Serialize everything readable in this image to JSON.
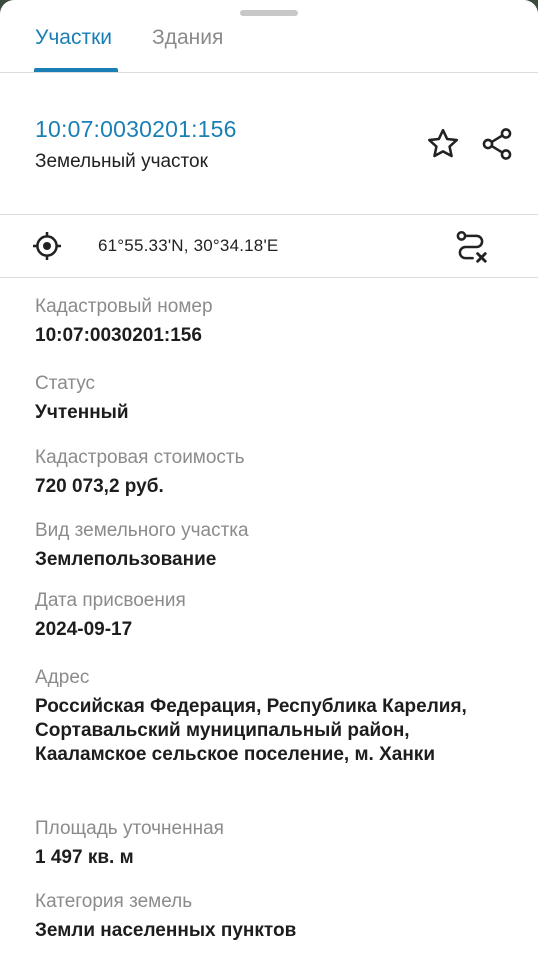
{
  "tabs": [
    {
      "label": "Участки",
      "active": true
    },
    {
      "label": "Здания",
      "active": false
    }
  ],
  "header": {
    "cadastral_number": "10:07:0030201:156",
    "object_type": "Земельный участок"
  },
  "icons": {
    "favorite": "star-outline-icon",
    "share": "share-icon",
    "locate": "crosshair-location-icon",
    "route": "route-cancel-icon"
  },
  "coordinates": "61°55.33'N, 30°34.18'E",
  "fields": [
    {
      "label": "Кадастровый номер",
      "value": "10:07:0030201:156"
    },
    {
      "label": "Статус",
      "value": "Учтенный"
    },
    {
      "label": "Кадастровая стоимость",
      "value": "720 073,2 руб."
    },
    {
      "label": "Вид земельного участка",
      "value": "Землепользование"
    },
    {
      "label": "Дата присвоения",
      "value": "2024-09-17"
    },
    {
      "label": "Адрес",
      "value": "Российская Федерация, Республика Карелия, Сортавальский муниципальный район, Кааламское сельское поселение, м. Ханки"
    },
    {
      "label": "Площадь уточненная",
      "value": "1 497 кв. м"
    },
    {
      "label": "Категория земель",
      "value": "Земли населенных пунктов"
    }
  ],
  "colors": {
    "accent": "#1a7fb5",
    "label": "#8b8b8b",
    "divider": "#dcdcdc"
  }
}
